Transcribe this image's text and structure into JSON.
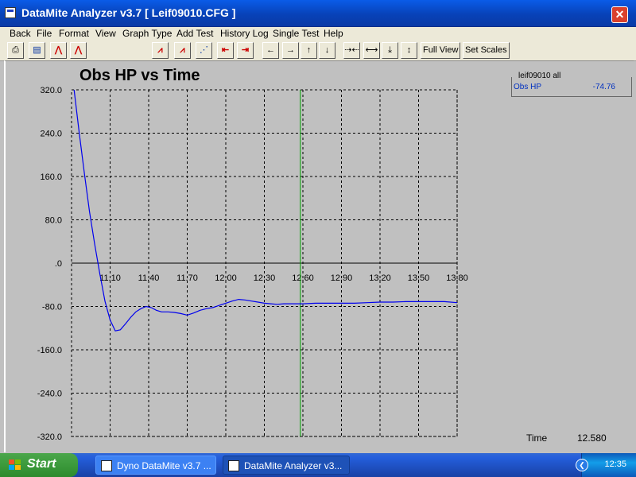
{
  "window": {
    "title": "DataMite Analyzer v3.7  [ Leif09010.CFG ]",
    "close_glyph": "✕"
  },
  "menu": [
    "Back",
    "File",
    "Format",
    "View",
    "Graph Type",
    "Add Test",
    "History Log",
    "Single Test",
    "Help"
  ],
  "toolbar": {
    "buttons": [
      {
        "name": "print-icon",
        "glyph": "⎙",
        "style": ""
      },
      {
        "name": "save-icon",
        "glyph": "▤",
        "style": "blue"
      },
      {
        "name": "graph-red-icon",
        "glyph": "⋀",
        "style": "red"
      },
      {
        "name": "graph-red-2-icon",
        "glyph": "⋀",
        "style": "red"
      },
      {
        "name": "graph-type-1-icon",
        "glyph": "⩘",
        "style": "red"
      },
      {
        "name": "graph-type-2-icon",
        "glyph": "⩘",
        "style": "red"
      },
      {
        "name": "graph-type-3-icon",
        "glyph": "⋰",
        "style": "blue"
      },
      {
        "name": "cursor-left-icon",
        "glyph": "⇤",
        "style": "red"
      },
      {
        "name": "cursor-right-icon",
        "glyph": "⇥",
        "style": "red"
      },
      {
        "name": "scroll-left-icon",
        "glyph": "←",
        "style": ""
      },
      {
        "name": "scroll-right-icon",
        "glyph": "→",
        "style": ""
      },
      {
        "name": "scroll-up-icon",
        "glyph": "↑",
        "style": ""
      },
      {
        "name": "scroll-down-icon",
        "glyph": "↓",
        "style": ""
      },
      {
        "name": "zoom-in-x-icon",
        "glyph": "⇢⇠",
        "style": ""
      },
      {
        "name": "zoom-out-x-icon",
        "glyph": "⟷",
        "style": ""
      },
      {
        "name": "zoom-in-y-icon",
        "glyph": "⤓",
        "style": ""
      },
      {
        "name": "zoom-out-y-icon",
        "glyph": "↕",
        "style": ""
      }
    ],
    "full_view": "Full View",
    "set_scales": "Set Scales"
  },
  "legend": {
    "header": "leif09010   all",
    "series_name": "Obs HP",
    "series_value": "-74.76"
  },
  "status": {
    "label": "Time",
    "value": "12.580"
  },
  "taskbar": {
    "start": "Start",
    "tasks": [
      "Dyno DataMite v3.7 ...",
      "DataMite Analyzer v3..."
    ],
    "clock": "12:35",
    "tray_arrow": "❮"
  },
  "colors": {
    "series": "#0000ee",
    "cursor": "#00a000"
  },
  "chart_data": {
    "type": "line",
    "title": "Obs HP vs Time",
    "xlabel": "",
    "ylabel": "",
    "xlim": [
      10.8,
      13.8
    ],
    "ylim": [
      -320,
      320
    ],
    "x_ticks": [
      "11.10",
      "11.40",
      "11.70",
      "12.00",
      "12.30",
      "12.60",
      "12.90",
      "13.20",
      "13.50",
      "13.80"
    ],
    "y_ticks": [
      "320.0",
      "240.0",
      "160.0",
      "80.0",
      ".0",
      "-80.0",
      "-160.0",
      "-240.0",
      "-320.0"
    ],
    "grid": true,
    "cursor_x": 12.58,
    "series": [
      {
        "x": [
          10.82,
          10.86,
          10.9,
          10.94,
          10.98,
          11.02,
          11.06,
          11.1,
          11.14,
          11.18,
          11.22,
          11.26,
          11.3,
          11.34,
          11.38,
          11.42,
          11.46,
          11.5,
          11.55,
          11.6,
          11.65,
          11.7,
          11.75,
          11.8,
          11.85,
          11.9,
          11.95,
          12.0,
          12.05,
          12.1,
          12.15,
          12.2,
          12.25,
          12.3,
          12.35,
          12.4,
          12.45,
          12.5,
          12.55,
          12.6,
          12.7,
          12.8,
          12.9,
          13.0,
          13.1,
          13.2,
          13.3,
          13.4,
          13.5,
          13.6,
          13.7,
          13.8
        ],
        "y": [
          320,
          240,
          165,
          95,
          35,
          -20,
          -70,
          -105,
          -125,
          -123,
          -112,
          -100,
          -90,
          -84,
          -80,
          -82,
          -87,
          -90,
          -90,
          -91,
          -93,
          -96,
          -92,
          -87,
          -84,
          -82,
          -78,
          -74,
          -70,
          -67,
          -68,
          -70,
          -72,
          -74,
          -75,
          -76,
          -75,
          -75,
          -75,
          -75,
          -74,
          -74,
          -74,
          -74,
          -73,
          -72,
          -72,
          -71,
          -71,
          -71,
          -71,
          -73
        ]
      }
    ]
  }
}
